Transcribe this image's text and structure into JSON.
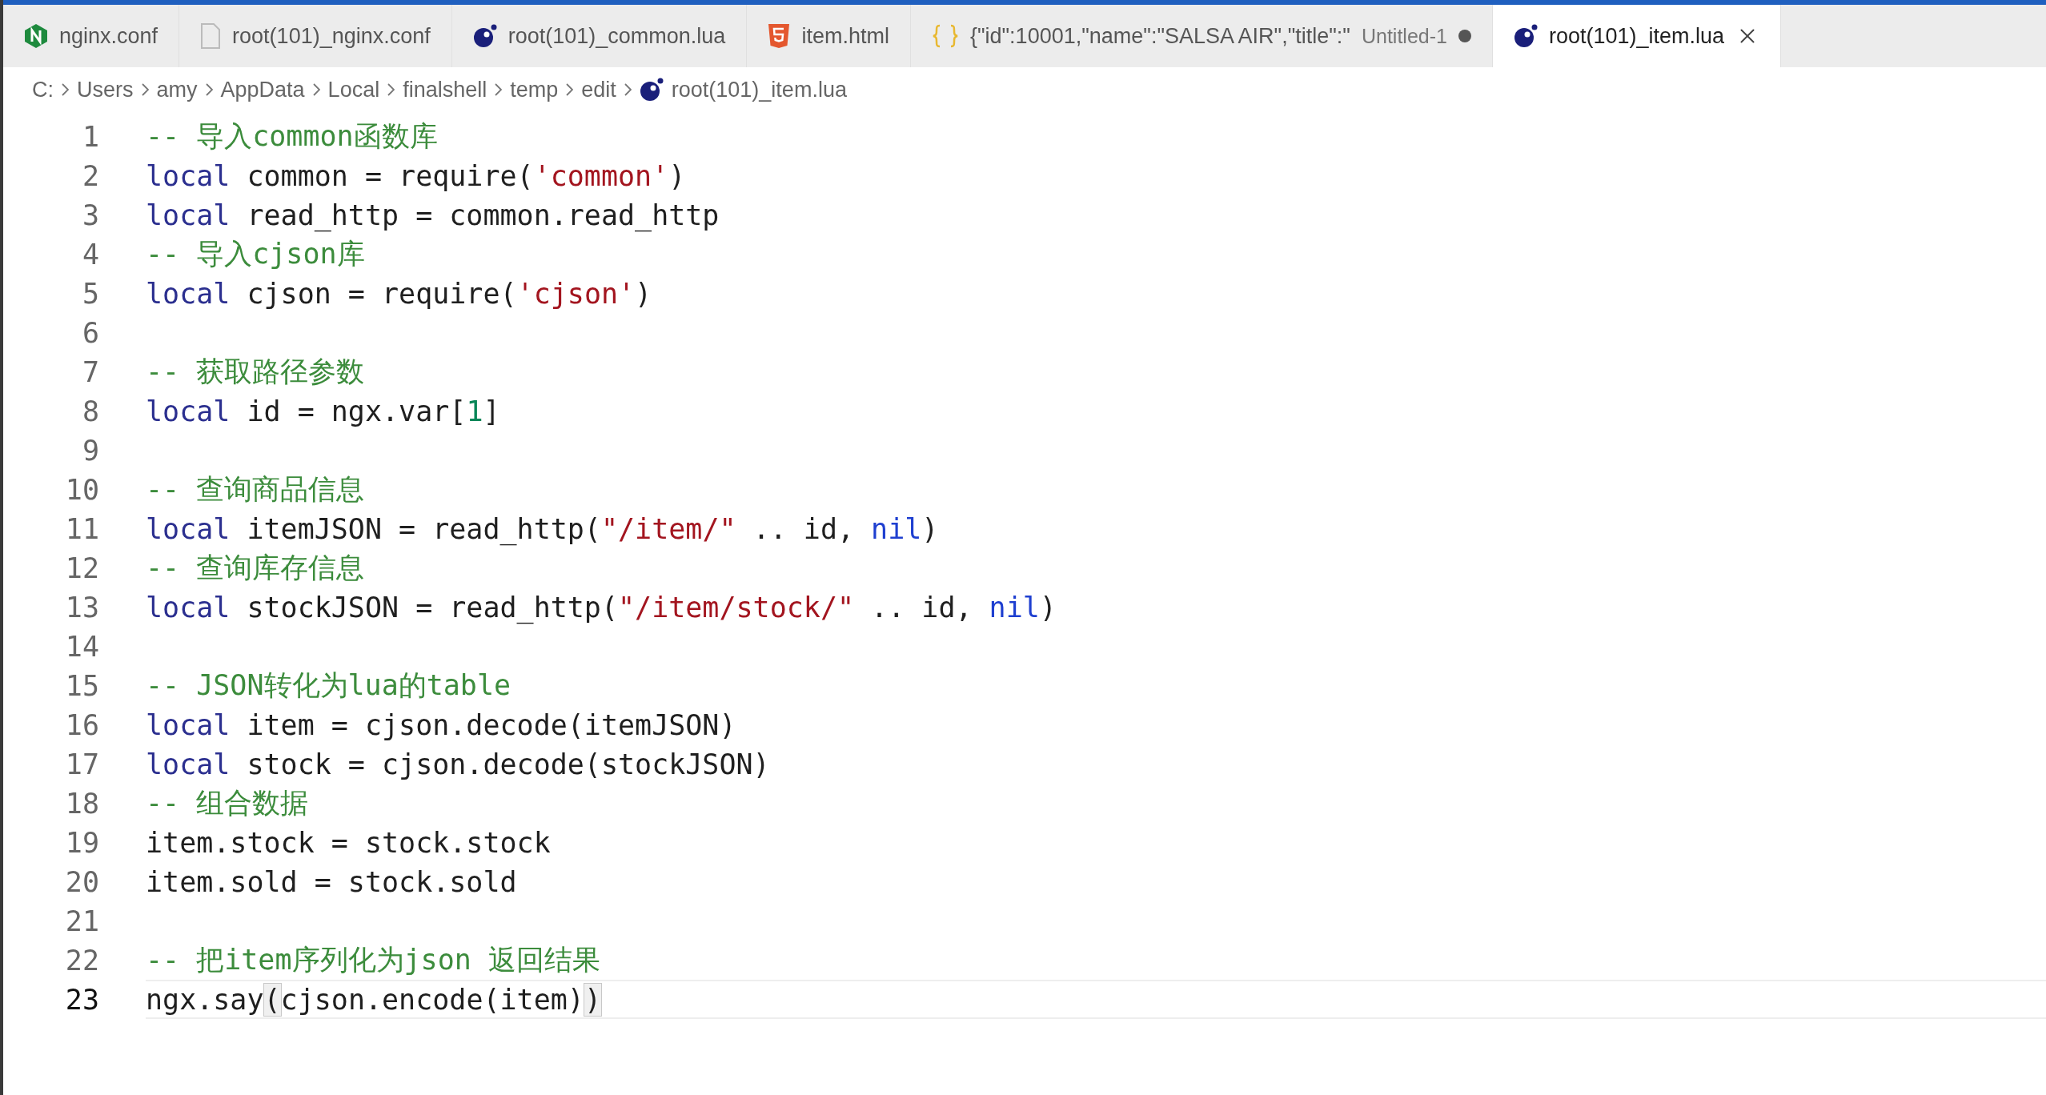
{
  "tabs": [
    {
      "kind": "nginx",
      "label": "nginx.conf",
      "selected": false,
      "dirty": false
    },
    {
      "kind": "text",
      "label": "root(101)_nginx.conf",
      "selected": false,
      "dirty": false
    },
    {
      "kind": "lua",
      "label": "root(101)_common.lua",
      "selected": false,
      "dirty": false
    },
    {
      "kind": "html",
      "label": "item.html",
      "selected": false,
      "dirty": false
    },
    {
      "kind": "json",
      "label": "{\"id\":10001,\"name\":\"SALSA AIR\",\"title\":\"",
      "description": "Untitled-1",
      "selected": false,
      "dirty": true
    },
    {
      "kind": "lua",
      "label": "root(101)_item.lua",
      "selected": true,
      "dirty": false
    }
  ],
  "breadcrumb": [
    {
      "label": "C:"
    },
    {
      "label": "Users"
    },
    {
      "label": "amy"
    },
    {
      "label": "AppData"
    },
    {
      "label": "Local"
    },
    {
      "label": "finalshell"
    },
    {
      "label": "temp"
    },
    {
      "label": "edit"
    },
    {
      "label": "root(101)_item.lua",
      "kind": "lua"
    }
  ],
  "editor": {
    "lines": [
      {
        "number": "1",
        "current": false,
        "tokens": [
          {
            "kind": "comment",
            "text": "-- 导入common函数库"
          }
        ]
      },
      {
        "number": "2",
        "current": false,
        "tokens": [
          {
            "kind": "keyword",
            "text": "local"
          },
          {
            "kind": "plain",
            "text": " common = require("
          },
          {
            "kind": "string",
            "text": "'common'"
          },
          {
            "kind": "plain",
            "text": ")"
          }
        ]
      },
      {
        "number": "3",
        "current": false,
        "tokens": [
          {
            "kind": "keyword",
            "text": "local"
          },
          {
            "kind": "plain",
            "text": " read_http = common.read_http"
          }
        ]
      },
      {
        "number": "4",
        "current": false,
        "tokens": [
          {
            "kind": "comment",
            "text": "-- 导入cjson库"
          }
        ]
      },
      {
        "number": "5",
        "current": false,
        "tokens": [
          {
            "kind": "keyword",
            "text": "local"
          },
          {
            "kind": "plain",
            "text": " cjson = require("
          },
          {
            "kind": "string",
            "text": "'cjson'"
          },
          {
            "kind": "plain",
            "text": ")"
          }
        ]
      },
      {
        "number": "6",
        "current": false
      },
      {
        "number": "7",
        "current": false,
        "tokens": [
          {
            "kind": "comment",
            "text": "-- 获取路径参数"
          }
        ]
      },
      {
        "number": "8",
        "current": false,
        "tokens": [
          {
            "kind": "keyword",
            "text": "local"
          },
          {
            "kind": "plain",
            "text": " id = ngx.var["
          },
          {
            "kind": "number",
            "text": "1"
          },
          {
            "kind": "plain",
            "text": "]"
          }
        ]
      },
      {
        "number": "9",
        "current": false
      },
      {
        "number": "10",
        "current": false,
        "tokens": [
          {
            "kind": "comment",
            "text": "-- 查询商品信息"
          }
        ]
      },
      {
        "number": "11",
        "current": false,
        "tokens": [
          {
            "kind": "keyword",
            "text": "local"
          },
          {
            "kind": "plain",
            "text": " itemJSON = read_http("
          },
          {
            "kind": "string",
            "text": "\"/item/\""
          },
          {
            "kind": "plain",
            "text": " .. id, "
          },
          {
            "kind": "constant",
            "text": "nil"
          },
          {
            "kind": "plain",
            "text": ")"
          }
        ]
      },
      {
        "number": "12",
        "current": false,
        "tokens": [
          {
            "kind": "comment",
            "text": "-- 查询库存信息"
          }
        ]
      },
      {
        "number": "13",
        "current": false,
        "tokens": [
          {
            "kind": "keyword",
            "text": "local"
          },
          {
            "kind": "plain",
            "text": " stockJSON = read_http("
          },
          {
            "kind": "string",
            "text": "\"/item/stock/\""
          },
          {
            "kind": "plain",
            "text": " .. id, "
          },
          {
            "kind": "constant",
            "text": "nil"
          },
          {
            "kind": "plain",
            "text": ")"
          }
        ]
      },
      {
        "number": "14",
        "current": false
      },
      {
        "number": "15",
        "current": false,
        "tokens": [
          {
            "kind": "comment",
            "text": "-- JSON转化为lua的table"
          }
        ]
      },
      {
        "number": "16",
        "current": false,
        "tokens": [
          {
            "kind": "keyword",
            "text": "local"
          },
          {
            "kind": "plain",
            "text": " item = cjson.decode(itemJSON)"
          }
        ]
      },
      {
        "number": "17",
        "current": false,
        "tokens": [
          {
            "kind": "keyword",
            "text": "local"
          },
          {
            "kind": "plain",
            "text": " stock = cjson.decode(stockJSON)"
          }
        ]
      },
      {
        "number": "18",
        "current": false,
        "tokens": [
          {
            "kind": "comment",
            "text": "-- 组合数据"
          }
        ]
      },
      {
        "number": "19",
        "current": false,
        "tokens": [
          {
            "kind": "plain",
            "text": "item.stock = stock.stock"
          }
        ]
      },
      {
        "number": "20",
        "current": false,
        "tokens": [
          {
            "kind": "plain",
            "text": "item.sold = stock.sold"
          }
        ]
      },
      {
        "number": "21",
        "current": false
      },
      {
        "number": "22",
        "current": false,
        "tokens": [
          {
            "kind": "comment",
            "text": "-- 把item序列化为json 返回结果"
          }
        ]
      },
      {
        "number": "23",
        "current": true,
        "tokens": [
          {
            "kind": "plain",
            "text": "ngx.say"
          },
          {
            "kind": "bracket",
            "text": "("
          },
          {
            "kind": "plain",
            "text": "cjson.encode(item)"
          },
          {
            "kind": "bracket",
            "text": ")"
          }
        ]
      }
    ]
  }
}
